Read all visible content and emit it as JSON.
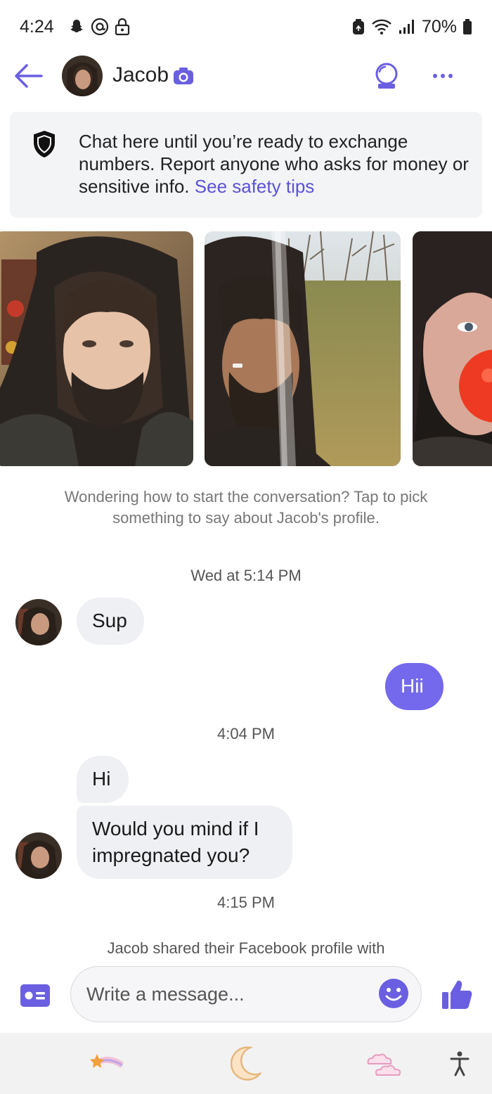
{
  "status_bar": {
    "time": "4:24",
    "battery": "70%"
  },
  "header": {
    "name": "Jacob"
  },
  "safety": {
    "text": "Chat here until you’re ready to exchange numbers. Report anyone who asks for money or sensitive info.",
    "link": "See safety tips"
  },
  "hint": "Wondering how to start the conversation? Tap to pick something to say about Jacob's profile.",
  "messages": {
    "ts1": "Wed at 5:14 PM",
    "m1": "Sup",
    "m2": "Hii",
    "ts2": "4:04 PM",
    "m3": "Hi",
    "m4": "Would you mind if I impregnated you?",
    "ts3": "4:15 PM",
    "shared": "Jacob shared their Facebook profile with"
  },
  "composer": {
    "placeholder": "Write a message..."
  },
  "colors": {
    "accent": "#7468ec",
    "link": "#5a53d6",
    "incoming_bubble": "#eff0f3"
  },
  "icons": [
    "back-arrow-icon",
    "camera-icon",
    "crystal-ball-icon",
    "more-icon",
    "shield-icon",
    "profile-card-icon",
    "emoji-icon",
    "thumbs-up-icon",
    "shooting-star-icon",
    "moon-icon",
    "clouds-icon",
    "accessibility-icon"
  ]
}
